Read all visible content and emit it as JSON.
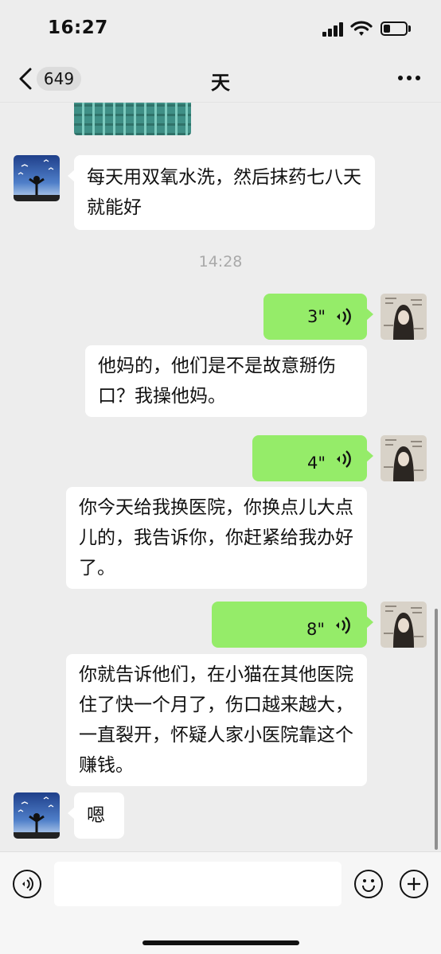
{
  "status_bar": {
    "time": "16:27"
  },
  "nav": {
    "unread_count": "649",
    "title": "天"
  },
  "messages": [
    {
      "text": "每天用双氧水洗，然后抹药七八天就能好"
    },
    {
      "text": "他妈的，他们是不是故意掰伤口？我操他妈。"
    },
    {
      "text": "你今天给我换医院，你换点儿大点儿的，我告诉你，你赶紧给我办好了。"
    },
    {
      "text": "你就告诉他们，在小猫在其他医院住了快一个月了，伤口越来越大，一直裂开，怀疑人家小医院靠这个赚钱。"
    },
    {
      "text": "嗯"
    }
  ],
  "timestamp": "14:28",
  "voice_messages": [
    {
      "duration": "3\""
    },
    {
      "duration": "4\""
    },
    {
      "duration": "8\""
    }
  ],
  "input": {
    "value": "",
    "placeholder": ""
  },
  "icons": {
    "back": "chevron-left-icon",
    "more": "more-dots-icon",
    "voice_input": "voice-input-icon",
    "emoji": "emoji-icon",
    "add": "plus-icon",
    "voice_wave": "voice-wave-icon"
  },
  "colors": {
    "background": "#ededed",
    "bubble_self": "#95ec69",
    "bubble_other": "#ffffff",
    "timestamp": "#a9a9a9"
  }
}
